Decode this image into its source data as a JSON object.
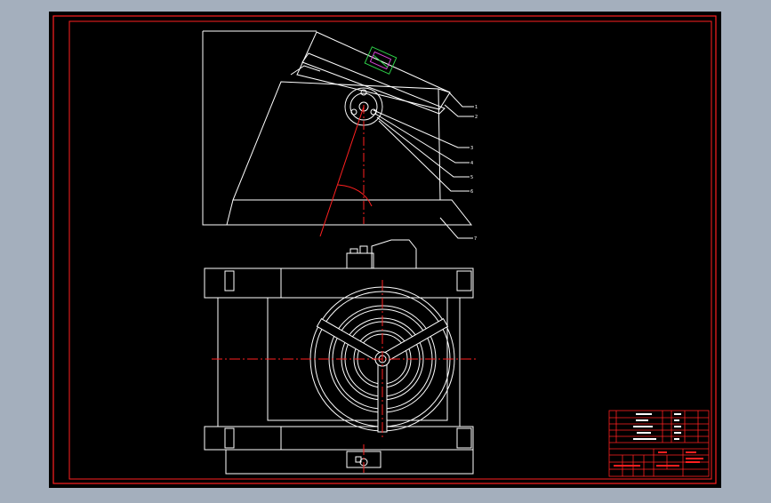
{
  "colors": {
    "background": "#a4afbd",
    "sheet": "#000000",
    "frame": "#ff2020",
    "lines": "#ffffff",
    "centerline": "#ff2020",
    "detail_green": "#2fd24a",
    "detail_magenta": "#d040d0"
  },
  "balloons": [
    "1",
    "2",
    "3",
    "4",
    "5",
    "6",
    "7"
  ],
  "title_block": {
    "rows": [
      "",
      "",
      "",
      "",
      "",
      "",
      ""
    ]
  }
}
